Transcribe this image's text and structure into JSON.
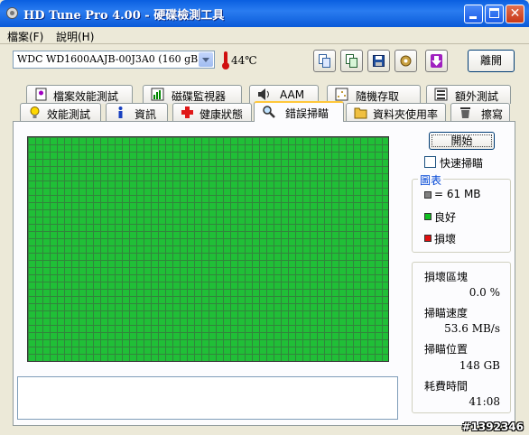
{
  "window": {
    "title": "HD Tune Pro 4.00 - 硬碟檢測工具"
  },
  "menu": [
    {
      "label": "檔案(F)"
    },
    {
      "label": "說明(H)"
    }
  ],
  "toolbar": {
    "drive": "WDC WD1600AAJB-00J3A0 (160 gB)",
    "temperature": "44℃",
    "exit_label": "離開"
  },
  "tabs_top": [
    {
      "label": "檔案效能測試",
      "icon": "file-benchmark-icon"
    },
    {
      "label": "磁碟監視器",
      "icon": "disk-monitor-icon"
    },
    {
      "label": "AAM",
      "icon": "speaker-icon"
    },
    {
      "label": "隨機存取",
      "icon": "random-access-icon"
    },
    {
      "label": "額外測試",
      "icon": "extra-tests-icon"
    }
  ],
  "tabs_bottom": [
    {
      "label": "效能測試",
      "icon": "bulb-icon"
    },
    {
      "label": "資訊",
      "icon": "info-icon"
    },
    {
      "label": "健康狀態",
      "icon": "health-cross-icon"
    },
    {
      "label": "錯誤掃瞄",
      "icon": "magnifier-icon"
    },
    {
      "label": "資料夾使用率",
      "icon": "folder-icon"
    },
    {
      "label": "擦寫",
      "icon": "trash-icon"
    }
  ],
  "scan": {
    "start_label": "開始",
    "quick_scan_label": "快速掃瞄",
    "legend_title": "圖表",
    "legend": [
      {
        "label": "= 61 MB",
        "color": "#808080"
      },
      {
        "label": "良好",
        "color": "#10c020"
      },
      {
        "label": "損壞",
        "color": "#e01010"
      }
    ],
    "stats": [
      {
        "label": "損壞區塊",
        "value": "0.0 %"
      },
      {
        "label": "掃瞄速度",
        "value": "53.6 MB/s"
      },
      {
        "label": "掃瞄位置",
        "value": "148 GB"
      },
      {
        "label": "耗費時間",
        "value": "41:08"
      }
    ]
  },
  "watermark": "#1392346"
}
